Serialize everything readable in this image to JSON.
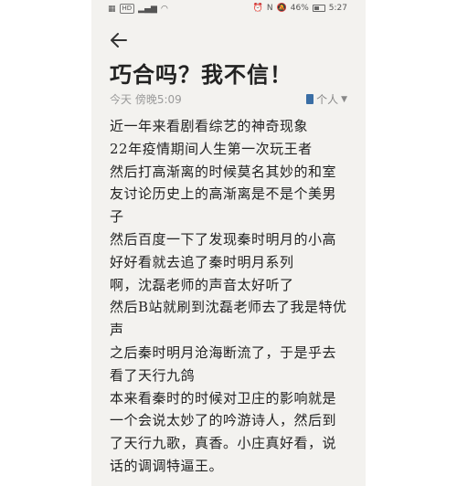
{
  "statusbar": {
    "left_icons": [
      "sim-icon",
      "signal-icon",
      "wifi-icon"
    ],
    "net_label": "HD",
    "right_icons": [
      "alarm-icon",
      "nfc-icon",
      "mute-icon"
    ],
    "battery": "46%",
    "time": "5:27"
  },
  "note": {
    "title": "巧合吗？我不信！",
    "date": "今天 傍晚5:09",
    "folder": "个人",
    "lines": [
      "近一年来看剧看综艺的神奇现象",
      "22年疫情期间人生第一次玩王者",
      "然后打高渐离的时候莫名其妙的和室",
      "友讨论历史上的高渐离是不是个美男",
      "子",
      "然后百度一下了发现秦时明月的小高",
      "好好看就去追了秦时明月系列",
      "啊，沈磊老师的声音太好听了",
      "然后B站就刷到沈磊老师去了我是特优",
      "声",
      "之后秦时明月沧海断流了，于是乎去",
      "看了天行九鸽",
      "本来看秦时的时候对卫庄的影响就是",
      "一个会说太妙了的吟游诗人，然后到",
      "了天行九歌，真香。小庄真好看，说",
      "话的调调特逼王。"
    ]
  },
  "colors": {
    "background": "#f3f2ef",
    "text": "#222222",
    "meta": "#9a9a9a",
    "folder_icon": "#3a6ea5"
  }
}
